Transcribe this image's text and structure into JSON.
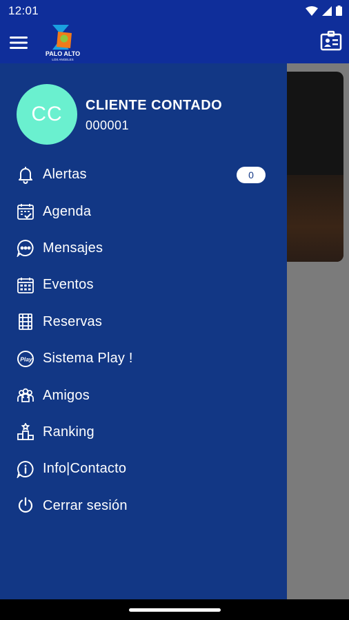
{
  "status_bar": {
    "time": "12:01"
  },
  "app_bar": {
    "logo_text": "PALO ALTO",
    "logo_subtext": "LOS ANGELES"
  },
  "drawer": {
    "avatar_initials": "CC",
    "user_name": "CLIENTE CONTADO",
    "user_id": "000001",
    "items": [
      {
        "label": "Alertas",
        "icon": "bell-icon",
        "badge": "0"
      },
      {
        "label": "Agenda",
        "icon": "calendar-check-icon"
      },
      {
        "label": "Mensajes",
        "icon": "chat-bubble-icon"
      },
      {
        "label": "Eventos",
        "icon": "calendar-grid-icon"
      },
      {
        "label": "Reservas",
        "icon": "court-icon"
      },
      {
        "label": "Sistema Play !",
        "icon": "play-badge-icon"
      },
      {
        "label": "Amigos",
        "icon": "friends-icon"
      },
      {
        "label": "Ranking",
        "icon": "podium-icon"
      },
      {
        "label": "Info|Contacto",
        "icon": "info-icon"
      },
      {
        "label": "Cerrar sesión",
        "icon": "power-icon"
      }
    ]
  },
  "colors": {
    "drawer_bg": "#123785",
    "app_bar_bg": "#0f2e9a",
    "avatar_bg": "#6af0cf"
  }
}
